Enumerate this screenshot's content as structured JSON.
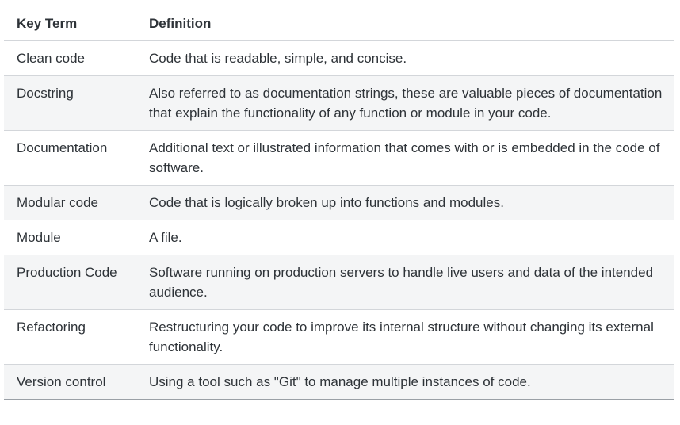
{
  "table": {
    "headers": {
      "term": "Key Term",
      "definition": "Definition"
    },
    "rows": [
      {
        "term": "Clean code",
        "definition": "Code that is readable, simple, and concise."
      },
      {
        "term": "Docstring",
        "definition": "Also referred to as documentation strings, these are valuable pieces of documentation that explain the functionality of any function or module in your code."
      },
      {
        "term": "Documentation",
        "definition": "Additional text or illustrated information that comes with or is embedded in the code of software."
      },
      {
        "term": "Modular code",
        "definition": "Code that is logically broken up into functions and modules."
      },
      {
        "term": "Module",
        "definition": "A file."
      },
      {
        "term": "Production Code",
        "definition": "Software running on production servers to handle live users and data of the intended audience."
      },
      {
        "term": "Refactoring",
        "definition": "Restructuring your code to improve its internal structure without changing its external functionality."
      },
      {
        "term": "Version control",
        "definition": "Using a tool such as \"Git\" to manage multiple instances of code."
      }
    ]
  },
  "colors": {
    "text": "#2e3338",
    "stripe": "#f4f5f6",
    "border": "#d3d6da"
  }
}
